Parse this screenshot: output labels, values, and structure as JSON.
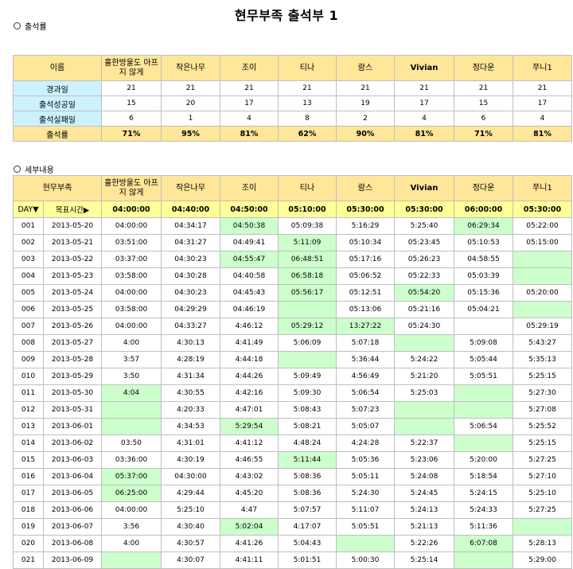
{
  "title": "현무부족 출석부 1",
  "section1_label": "출석률",
  "section2_label": "세부내용",
  "colors": {
    "header": "#ffe699",
    "label": "#ccf2ff",
    "target": "#ffff99",
    "highlight": "#ccffcc"
  },
  "summary": {
    "name_header": "이름",
    "members": [
      "흘한방울도 아프지 않게",
      "작은나무",
      "조이",
      "티나",
      "람스",
      "Vivian",
      "정다운",
      "쭈니1"
    ],
    "rows": [
      {
        "label": "경과일",
        "values": [
          "21",
          "21",
          "21",
          "21",
          "21",
          "21",
          "21",
          "21"
        ]
      },
      {
        "label": "출석성공일",
        "values": [
          "15",
          "20",
          "17",
          "13",
          "19",
          "17",
          "15",
          "17"
        ]
      },
      {
        "label": "출석실패일",
        "values": [
          "6",
          "1",
          "4",
          "8",
          "2",
          "4",
          "6",
          "4"
        ]
      }
    ],
    "rate": {
      "label": "출석률",
      "values": [
        "71%",
        "95%",
        "81%",
        "62%",
        "90%",
        "81%",
        "71%",
        "81%"
      ]
    }
  },
  "detail": {
    "header_label": "현무부족",
    "target": {
      "day_label": "DAY▼",
      "target_label": "목표시간▶",
      "values": [
        "04:00:00",
        "04:40:00",
        "04:50:00",
        "05:10:00",
        "05:30:00",
        "05:30:00",
        "06:00:00",
        "05:30:00"
      ]
    },
    "rows": [
      {
        "n": "001",
        "date": "2013-05-20",
        "vals": [
          "04:00:00",
          "04:34:17",
          "04:50:38",
          "05:09:38",
          "5:16:29",
          "5:25:40",
          "06:29:34",
          "05:22:00"
        ],
        "hl": [
          2,
          6
        ]
      },
      {
        "n": "002",
        "date": "2013-05-21",
        "vals": [
          "03:51:00",
          "04:31:27",
          "04:49:41",
          "5:11:09",
          "05:10:34",
          "05:23:45",
          "05:10:53",
          "05:15:00"
        ],
        "hl": [
          3
        ]
      },
      {
        "n": "003",
        "date": "2013-05-22",
        "vals": [
          "03:37:00",
          "04:30:23",
          "04:55:47",
          "06:48:51",
          "05:17:16",
          "05:26:23",
          "04:58:55",
          ""
        ],
        "hl": [
          2,
          3,
          7
        ]
      },
      {
        "n": "004",
        "date": "2013-05-23",
        "vals": [
          "03:58:00",
          "04:30:28",
          "04:40:58",
          "06:58:18",
          "05:06:52",
          "05:22:33",
          "05:03:39",
          ""
        ],
        "hl": [
          3,
          7
        ]
      },
      {
        "n": "005",
        "date": "2013-05-24",
        "vals": [
          "04:00:00",
          "04:30:23",
          "04:45:43",
          "05:56:17",
          "05:12:51",
          "05:54:20",
          "05:15:36",
          "05:20:00"
        ],
        "hl": [
          3,
          5
        ]
      },
      {
        "n": "006",
        "date": "2013-05-25",
        "vals": [
          "03:58:00",
          "04:29:29",
          "04:46:19",
          "",
          "05:13:06",
          "05:21:16",
          "05:04:21",
          ""
        ],
        "hl": [
          3,
          7
        ]
      },
      {
        "n": "007",
        "date": "2013-05-26",
        "vals": [
          "04:00:00",
          "04:33:27",
          "4:46:12",
          "05:29:12",
          "13:27:22",
          "05:24:30",
          "",
          "05:29:19"
        ],
        "hl": [
          3,
          4
        ]
      },
      {
        "n": "008",
        "date": "2013-05-27",
        "vals": [
          "4:00",
          "4:30:13",
          "4:41:49",
          "5:06:09",
          "5:07:18",
          "",
          "5:09:08",
          "5:43:27"
        ],
        "hl": [
          5
        ]
      },
      {
        "n": "009",
        "date": "2013-05-28",
        "vals": [
          "3:57",
          "4:28:19",
          "4:44:18",
          "",
          "5:36:44",
          "5:24:22",
          "5:05:44",
          "5:35:13"
        ],
        "hl": [
          3
        ]
      },
      {
        "n": "010",
        "date": "2013-05-29",
        "vals": [
          "3:50",
          "4:31:34",
          "4:44:26",
          "5:09:49",
          "4:56:49",
          "5:21:20",
          "5:05:51",
          "5:25:15"
        ],
        "hl": []
      },
      {
        "n": "011",
        "date": "2013-05-30",
        "vals": [
          "4:04",
          "4:30:55",
          "4:42:16",
          "5:09:30",
          "5:06:54",
          "5:25:03",
          "",
          "5:27:30"
        ],
        "hl": [
          0,
          6
        ]
      },
      {
        "n": "012",
        "date": "2013-05-31",
        "vals": [
          "",
          "4:20:33",
          "4:47:01",
          "5:08:43",
          "5:07:23",
          "",
          "",
          "5:27:08"
        ],
        "hl": [
          0,
          5,
          6
        ]
      },
      {
        "n": "013",
        "date": "2013-06-01",
        "vals": [
          "",
          "4:34:53",
          "5:29:54",
          "5:08:21",
          "5:05:07",
          "",
          "5:06:54",
          "5:25:52"
        ],
        "hl": [
          0,
          2,
          5
        ]
      },
      {
        "n": "014",
        "date": "2013-06-02",
        "vals": [
          "03:50",
          "4:31:01",
          "4:41:12",
          "4:48:24",
          "4:24:28",
          "5:22:37",
          "",
          "5:25:15"
        ],
        "hl": [
          6
        ]
      },
      {
        "n": "015",
        "date": "2013-06-03",
        "vals": [
          "03:36:00",
          "4:30:19",
          "4:46:55",
          "5:11:44",
          "5:05:36",
          "5:23:06",
          "5:20:00",
          "5:27:25"
        ],
        "hl": [
          3
        ]
      },
      {
        "n": "016",
        "date": "2013-06-04",
        "vals": [
          "05:37:00",
          "04:30:00",
          "4:43:02",
          "5:08:36",
          "5:05:11",
          "5:24:08",
          "5:18:54",
          "5:27:10"
        ],
        "hl": [
          0
        ]
      },
      {
        "n": "017",
        "date": "2013-06-05",
        "vals": [
          "06:25:00",
          "4:29:44",
          "4:45:20",
          "5:08:36",
          "5:24:30",
          "5:24:45",
          "5:24:15",
          "5:25:10"
        ],
        "hl": [
          0
        ]
      },
      {
        "n": "018",
        "date": "2013-06-06",
        "vals": [
          "04:00:00",
          "5:25:10",
          "4:47",
          "5:07:57",
          "5:11:07",
          "5:24:13",
          "5:24:33",
          "5:27:25"
        ],
        "hl": []
      },
      {
        "n": "019",
        "date": "2013-06-07",
        "vals": [
          "3:56",
          "4:30:40",
          "5:02:04",
          "4:17:07",
          "5:05:51",
          "5:21:13",
          "5:11:36",
          ""
        ],
        "hl": [
          2,
          7
        ]
      },
      {
        "n": "020",
        "date": "2013-06-08",
        "vals": [
          "4:00",
          "4:30:57",
          "4:41:26",
          "5:04:43",
          "",
          "5:22:26",
          "6:07:08",
          "5:28:13"
        ],
        "hl": [
          4,
          6
        ]
      },
      {
        "n": "021",
        "date": "2013-06-09",
        "vals": [
          "",
          "4:30:07",
          "4:41:11",
          "5:01:51",
          "5:00:30",
          "5:25:14",
          "",
          "5:29:00"
        ],
        "hl": [
          0,
          6
        ]
      }
    ]
  }
}
